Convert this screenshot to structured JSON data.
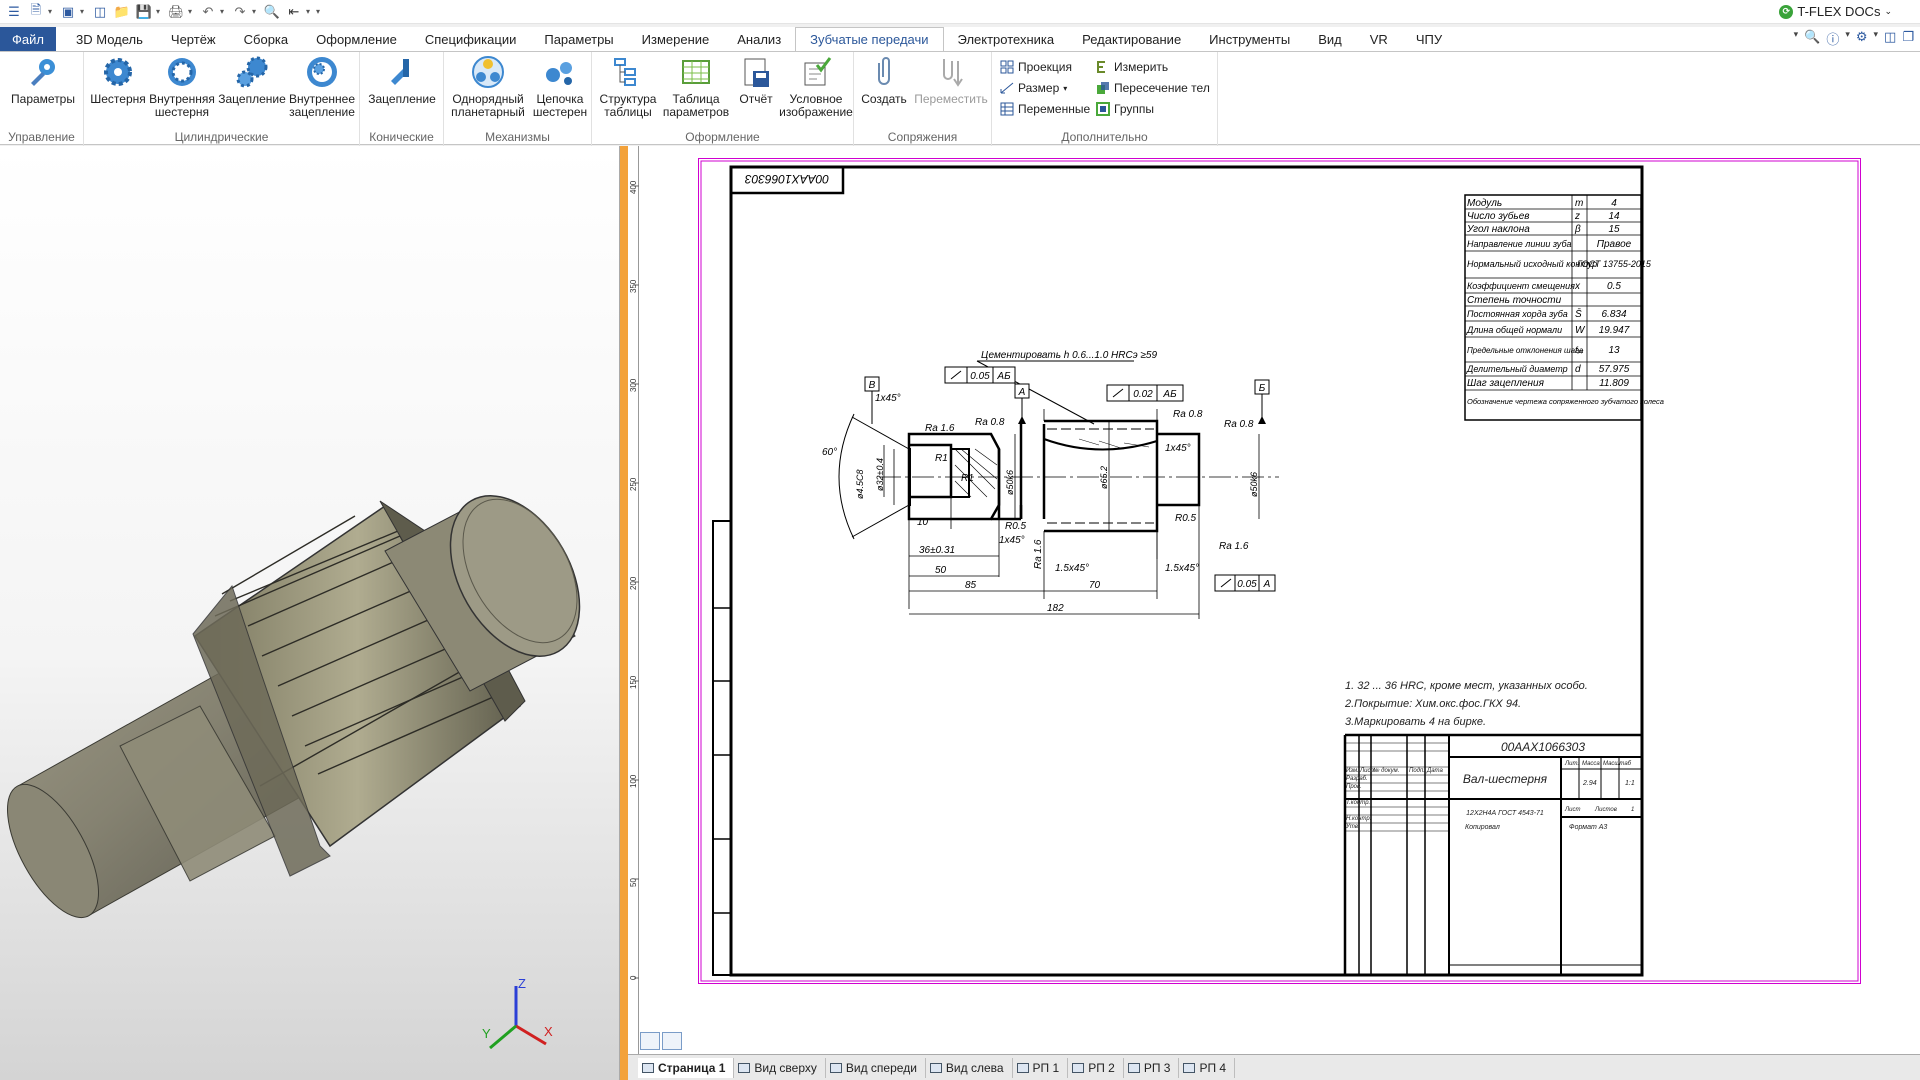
{
  "app": {
    "brand": "T-FLEX DOCs",
    "brand_suffix": "⌄"
  },
  "menu": {
    "tabs": [
      "Файл",
      "3D Модель",
      "Чертёж",
      "Сборка",
      "Оформление",
      "Спецификации",
      "Параметры",
      "Измерение",
      "Анализ",
      "Зубчатые передачи",
      "Электротехника",
      "Редактирование",
      "Инструменты",
      "Вид",
      "VR",
      "ЧПУ"
    ],
    "active_index": 9
  },
  "ribbon": {
    "g1": {
      "label": "Управление",
      "b1": [
        "Параметры",
        ""
      ]
    },
    "g2": {
      "label": "Цилиндрические",
      "b1": [
        "Шестерня",
        ""
      ],
      "b2": [
        "Внутренняя",
        "шестерня"
      ],
      "b3": [
        "Зацепление",
        ""
      ],
      "b4": [
        "Внутреннее",
        "зацепление"
      ]
    },
    "g3": {
      "label": "Конические",
      "b1": [
        "Зацепление",
        ""
      ]
    },
    "g4": {
      "label": "Механизмы",
      "b1": [
        "Однорядный",
        "планетарный"
      ],
      "b2": [
        "Цепочка",
        "шестерен"
      ]
    },
    "g5": {
      "label": "Оформление",
      "b1": [
        "Структура",
        "таблицы"
      ],
      "b2": [
        "Таблица",
        "параметров"
      ],
      "b3": [
        "Отчёт",
        ""
      ],
      "b4": [
        "Условное",
        "изображение"
      ]
    },
    "g6": {
      "label": "Сопряжения",
      "b1": [
        "Создать",
        ""
      ],
      "b2": [
        "Переместить",
        ""
      ]
    },
    "g7": {
      "label": "Дополнительно",
      "s1": "Проекция",
      "s2": "Размер",
      "s3": "Переменные",
      "s4": "Измерить",
      "s5": "Пересечение тел",
      "s6": "Группы"
    }
  },
  "axes": {
    "x": "X",
    "y": "Y",
    "z": "Z"
  },
  "ruler": {
    "ticks": [
      "400",
      "350",
      "300",
      "250",
      "200",
      "150",
      "100",
      "50",
      "0"
    ]
  },
  "drawing": {
    "code_top": "00ААХ1066303",
    "params": [
      [
        "Модуль",
        "m",
        "4"
      ],
      [
        "Число зубьев",
        "z",
        "14"
      ],
      [
        "Угол наклона",
        "β",
        "15"
      ],
      [
        "Направление линии зуба",
        "",
        "Правое"
      ],
      [
        "Нормальный исходный контур",
        "",
        "ГОСТ 13755-2015"
      ],
      [
        "Коэффициент смещения",
        "x",
        "0.5"
      ],
      [
        "Степень точности",
        "",
        ""
      ],
      [
        "Постоянная хорда зуба",
        "S̄",
        "6.834"
      ],
      [
        "Длина общей нормали",
        "W",
        "19.947"
      ],
      [
        "Предельные отклонения шага",
        "fₚᵣ",
        "13"
      ],
      [
        "Делительный диаметр",
        "d",
        "57.975"
      ],
      [
        "Шаг зацепления",
        "",
        "11.809"
      ],
      [
        "Обозначение чертежа сопряженного зубчатого колеса",
        "",
        ""
      ]
    ],
    "note_hardening": "Цементировать h 0.6...1.0 HRCэ ≥59",
    "tol1": "0.05",
    "tol1_ref": "АБ",
    "tol2": "0.02",
    "tol2_ref": "АБ",
    "tol3": "0.05",
    "tol3_ref": "А",
    "datum_a": "А",
    "datum_b": "Б",
    "datum_v": "В",
    "dims": {
      "chamfer1": "1x45°",
      "angle60": "60°",
      "d_bore": "ø4.5С8",
      "d32": "ø32±0.4",
      "d50k6a": "ø50k6",
      "d65": "ø65.2",
      "d50k6b": "ø50k6",
      "ra16a": "Ra 1.6",
      "ra08a": "Ra 0.8",
      "ra08b": "Ra 0.8",
      "ra08c": "Ra 0.8",
      "ra16b": "Ra 1.6",
      "ra16c": "Ra 1.6",
      "r1a": "R1",
      "r1b": "R1",
      "r05a": "R0.5",
      "r05b": "R0.5",
      "d10": "10",
      "d36": "36±0.31",
      "d50": "50",
      "d85": "85",
      "d70": "70",
      "d182": "182",
      "ch2": "1x45°",
      "ch3": "1.5x45°",
      "ch4": "1.5x45°",
      "ch5": "1x45°"
    },
    "notes": [
      "1. 32 ... 36 HRC, кроме мест, указанных особо.",
      "2.Покрытие: Хим.окс.фос.ГКХ 94.",
      "3.Маркировать 4 на бирке."
    ],
    "title_block": {
      "code": "00ААХ1066303",
      "name": "Вал-шестерня",
      "material": "12Х2Н4А ГОСТ 4543-71",
      "copied": "Копировал",
      "format": "Формат А3",
      "lit": "Лит.",
      "mass": "Масса",
      "scale": "Масштаб",
      "mass_val": "2.94",
      "scale_val": "1:1",
      "sheet": "Лист",
      "sheets": "Листов",
      "sheets_val": "1",
      "rows": [
        "Разраб.",
        "Пров.",
        "Т.контр.",
        "Н.контр.",
        "Утв."
      ],
      "hdr": [
        "Изм.",
        "Лист",
        "№ докум.",
        "Подп.",
        "Дата"
      ]
    }
  },
  "sheet_tabs": [
    "Страница 1",
    "Вид сверху",
    "Вид спереди",
    "Вид слева",
    "РП 1",
    "РП 2",
    "РП 3",
    "РП 4"
  ]
}
